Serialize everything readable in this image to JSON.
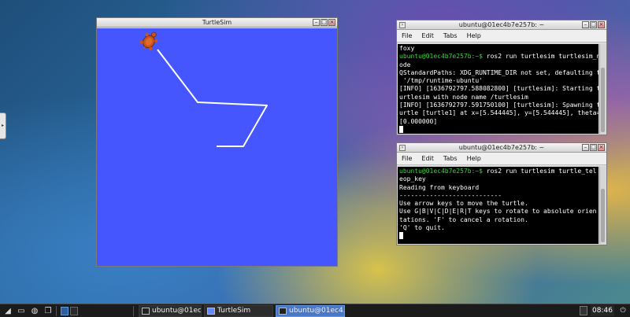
{
  "turtlesim": {
    "title": "TurtleSim",
    "background": "#4556ff",
    "path_color": "#ffffff"
  },
  "terminal1": {
    "title": "ubuntu@01ec4b7e257b: ~",
    "menu": [
      "File",
      "Edit",
      "Tabs",
      "Help"
    ],
    "lines": [
      {
        "text": "foxy"
      },
      {
        "prompt": "ubuntu@01ec4b7e257b:~$",
        "text": " ros2 run turtlesim turtlesim_n"
      },
      {
        "text": "ode"
      },
      {
        "text": "QStandardPaths: XDG_RUNTIME_DIR not set, defaulting to"
      },
      {
        "text": " '/tmp/runtime-ubuntu'"
      },
      {
        "text": "[INFO] [1636792797.588082800] [turtlesim]: Starting t"
      },
      {
        "text": "urtlesim with node name /turtlesim"
      },
      {
        "text": "[INFO] [1636792797.591750100] [turtlesim]: Spawning t"
      },
      {
        "text": "urtle [turtle1] at x=[5.544445], y=[5.544445], theta="
      },
      {
        "text": "[0.000000]"
      }
    ]
  },
  "terminal2": {
    "title": "ubuntu@01ec4b7e257b: ~",
    "menu": [
      "File",
      "Edit",
      "Tabs",
      "Help"
    ],
    "lines": [
      {
        "prompt": "ubuntu@01ec4b7e257b:~$",
        "text": " ros2 run turtlesim turtle_tel"
      },
      {
        "text": "eop_key"
      },
      {
        "text": "Reading from keyboard"
      },
      {
        "text": "---------------------------"
      },
      {
        "text": "Use arrow keys to move the turtle."
      },
      {
        "text": "Use G|B|V|C|D|E|R|T keys to rotate to absolute orien"
      },
      {
        "text": "tations. 'F' to cancel a rotation."
      },
      {
        "text": "'Q' to quit."
      }
    ]
  },
  "taskbar": {
    "tasks": [
      {
        "label": "ubuntu@01ec4...",
        "type": "terminal",
        "active": false
      },
      {
        "label": "TurtleSim",
        "type": "turtle",
        "active": false
      },
      {
        "label": "ubuntu@01ec4...",
        "type": "terminal",
        "active": true
      }
    ],
    "clock": "08:46"
  },
  "colors": {
    "prompt": "#3dd13d",
    "active_task": "#4a78c8",
    "taskbar": "#1b1b1b"
  },
  "icons": {
    "desktop_tab": "chevron-right-icon",
    "menu": "start-menu-icon",
    "file_manager": "folder-icon",
    "terminal": "terminal-icon",
    "end": "power-icon"
  }
}
